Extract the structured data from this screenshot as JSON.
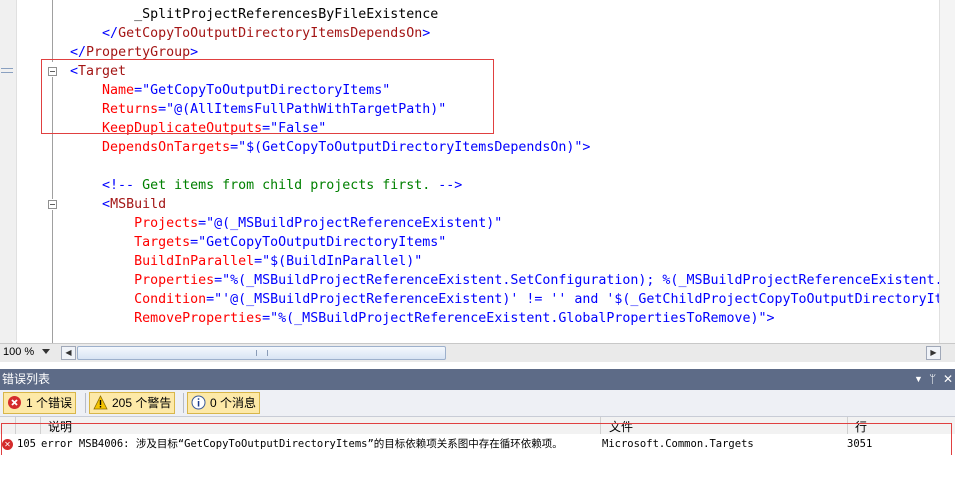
{
  "editor": {
    "lines": [
      [
        {
          "c": "black",
          "t": "            _SplitProjectReferencesByFileExistence"
        }
      ],
      [
        {
          "c": "blue",
          "t": "        </"
        },
        {
          "c": "maroon",
          "t": "GetCopyToOutputDirectoryItemsDependsOn"
        },
        {
          "c": "blue",
          "t": ">"
        }
      ],
      [
        {
          "c": "blue",
          "t": "    </"
        },
        {
          "c": "maroon",
          "t": "PropertyGroup"
        },
        {
          "c": "blue",
          "t": ">"
        }
      ],
      [
        {
          "c": "blue",
          "t": "    <"
        },
        {
          "c": "maroon",
          "t": "Target"
        }
      ],
      [
        {
          "c": "red",
          "t": "        Name"
        },
        {
          "c": "blue",
          "t": "=\"GetCopyToOutputDirectoryItems\""
        }
      ],
      [
        {
          "c": "red",
          "t": "        Returns"
        },
        {
          "c": "blue",
          "t": "=\"@(AllItemsFullPathWithTargetPath)\""
        }
      ],
      [
        {
          "c": "red",
          "t": "        KeepDuplicateOutputs"
        },
        {
          "c": "blue",
          "t": "=\"False\""
        }
      ],
      [
        {
          "c": "red",
          "t": "        DependsOnTargets"
        },
        {
          "c": "blue",
          "t": "=\"$(GetCopyToOutputDirectoryItemsDependsOn)\">"
        }
      ],
      [
        {
          "c": "black",
          "t": ""
        }
      ],
      [
        {
          "c": "blue",
          "t": "        <!--"
        },
        {
          "c": "green",
          "t": " Get items from child projects first. "
        },
        {
          "c": "blue",
          "t": "-->"
        }
      ],
      [
        {
          "c": "blue",
          "t": "        <"
        },
        {
          "c": "maroon",
          "t": "MSBuild"
        }
      ],
      [
        {
          "c": "red",
          "t": "            Projects"
        },
        {
          "c": "blue",
          "t": "=\"@(_MSBuildProjectReferenceExistent)\""
        }
      ],
      [
        {
          "c": "red",
          "t": "            Targets"
        },
        {
          "c": "blue",
          "t": "=\"GetCopyToOutputDirectoryItems\""
        }
      ],
      [
        {
          "c": "red",
          "t": "            BuildInParallel"
        },
        {
          "c": "blue",
          "t": "=\"$(BuildInParallel)\""
        }
      ],
      [
        {
          "c": "red",
          "t": "            Properties"
        },
        {
          "c": "blue",
          "t": "=\"%(_MSBuildProjectReferenceExistent.SetConfiguration); %(_MSBuildProjectReferenceExistent."
        }
      ],
      [
        {
          "c": "red",
          "t": "            Condition"
        },
        {
          "c": "blue",
          "t": "=\"'@(_MSBuildProjectReferenceExistent)' != '' and '$(_GetChildProjectCopyToOutputDirectoryIt"
        }
      ],
      [
        {
          "c": "red",
          "t": "            RemoveProperties"
        },
        {
          "c": "blue",
          "t": "=\"%(_MSBuildProjectReferenceExistent.GlobalPropertiesToRemove)\">"
        }
      ]
    ]
  },
  "status": {
    "zoom": "100 %"
  },
  "error_list": {
    "title": "错误列表",
    "pin_icon": "pin-icon",
    "close_icon": "close-icon",
    "filters": {
      "errors": "1 个错误",
      "warnings": "205 个警告",
      "messages": "0 个消息"
    },
    "columns": {
      "description": "说明",
      "file": "文件",
      "line": "行"
    },
    "rows": [
      {
        "index": "105",
        "description": "error MSB4006: 涉及目标“GetCopyToOutputDirectoryItems”的目标依赖项关系图中存在循环依赖项。",
        "file": "Microsoft.Common.Targets",
        "line": "3051"
      }
    ]
  },
  "colors": {
    "panel_title": "#5d6b87",
    "highlight": "#e04040",
    "active_filter": "#fde9a8"
  }
}
